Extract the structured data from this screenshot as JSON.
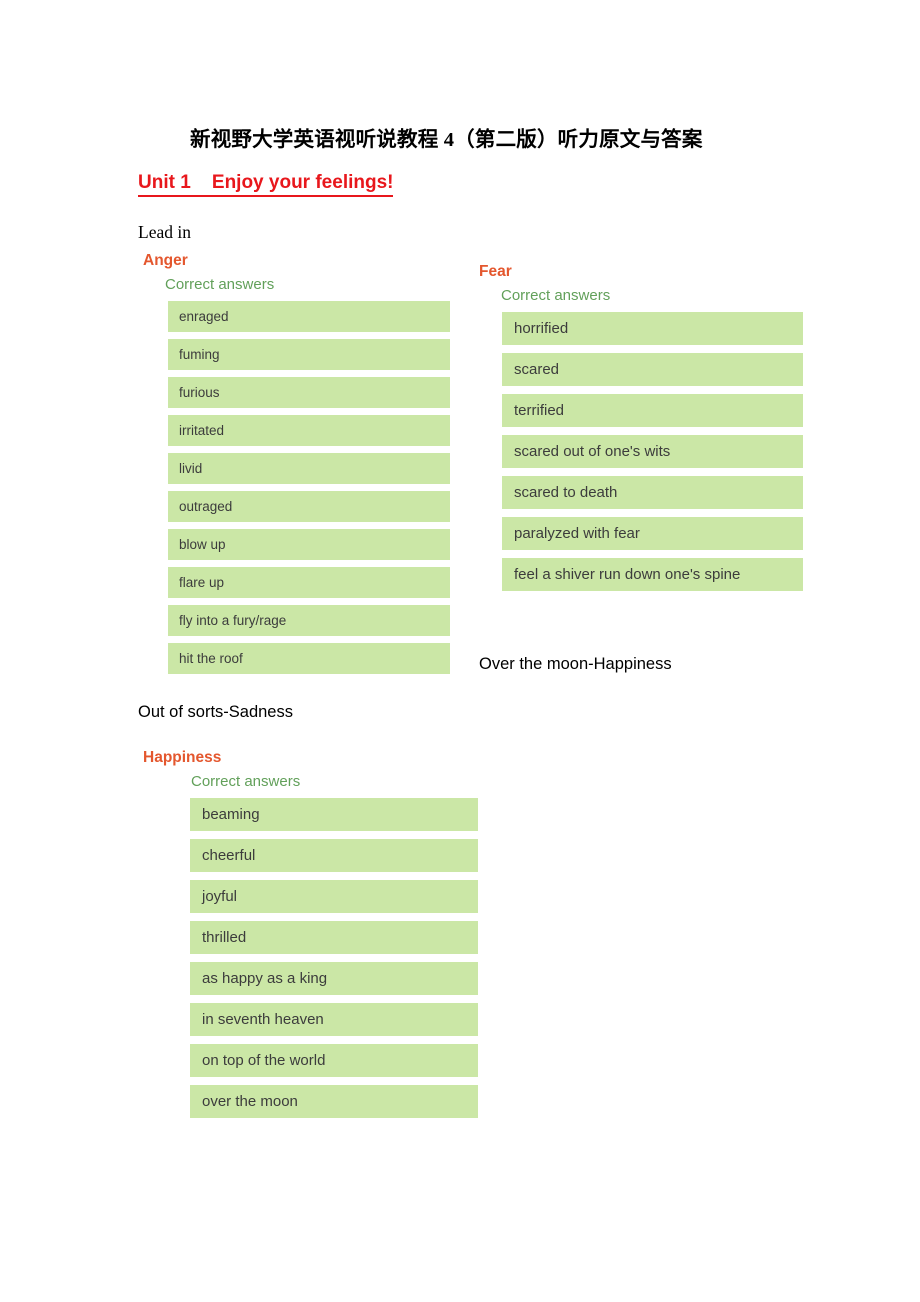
{
  "document": {
    "title": "新视野大学英语视听说教程 4（第二版）听力原文与答案",
    "unit_heading": "Unit 1    Enjoy your feelings!",
    "lead_in_label": "Lead in",
    "note_over_the_moon": "Over the moon-Happiness",
    "note_out_of_sorts": "Out of sorts-Sadness"
  },
  "colors": {
    "unit_heading": "#e8171c",
    "emotion_heading": "#e4572e",
    "correct_answers_label": "#62a05a",
    "answer_box_background": "#cbe7a6",
    "answer_text": "#3c3c3c",
    "page_background": "#ffffff"
  },
  "quiz_blocks": [
    {
      "emotion": "Anger",
      "correct_answers_label": "Correct answers",
      "answers": [
        "enraged",
        "fuming",
        "furious",
        "irritated",
        "livid",
        "outraged",
        "blow up",
        "flare up",
        "fly into a fury/rage",
        "hit the roof"
      ]
    },
    {
      "emotion": "Fear",
      "correct_answers_label": "Correct answers",
      "answers": [
        "horrified",
        "scared",
        "terrified",
        "scared out of one's wits",
        "scared to death",
        "paralyzed with fear",
        "feel a shiver run down one's spine"
      ]
    },
    {
      "emotion": "Happiness",
      "correct_answers_label": "Correct answers",
      "answers": [
        "beaming",
        "cheerful",
        "joyful",
        "thrilled",
        "as happy as a king",
        "in seventh heaven",
        "on top of the world",
        "over the moon"
      ]
    }
  ]
}
